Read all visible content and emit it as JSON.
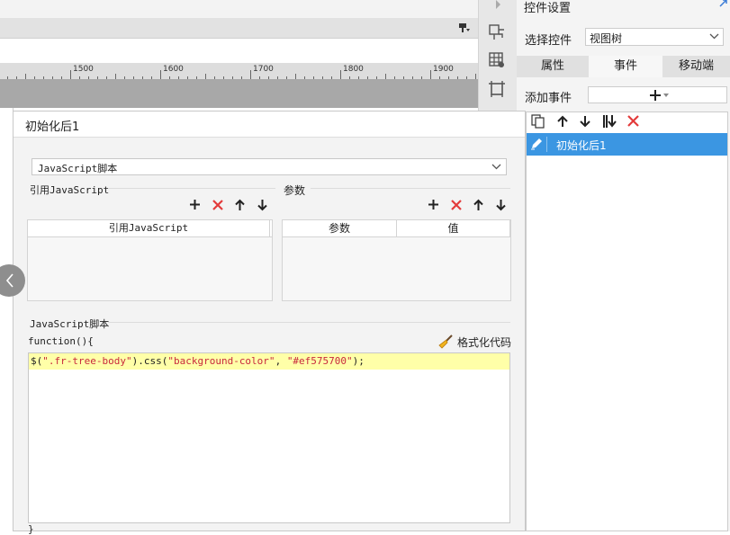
{
  "ruler": {
    "ticks": [
      "1500",
      "1600",
      "1700",
      "1800",
      "1900"
    ]
  },
  "right_panel": {
    "title": "控件设置",
    "select_label": "选择控件",
    "select_value": "视图树",
    "tabs": [
      "属性",
      "事件",
      "移动端"
    ],
    "active_tab": "事件",
    "add_event_label": "添加事件",
    "events": [
      {
        "label": "初始化后1",
        "selected": true
      }
    ]
  },
  "dialog": {
    "title": "初始化后1",
    "type_value": "JavaScript脚本",
    "ref_js_section": "引用JavaScript",
    "params_section": "参数",
    "ref_js_column": "引用JavaScript",
    "param_columns": [
      "参数",
      "值"
    ],
    "script_section": "JavaScript脚本",
    "function_header": "function(){",
    "format_label": "格式化代码",
    "code": {
      "dollar": "$(",
      "selector": "\".fr-tree-body\"",
      "method": ").css(",
      "arg1": "\"background-color\"",
      "comma": ", ",
      "arg2": "\"#ef575700\"",
      "end": ");"
    },
    "closing": "}"
  },
  "colors": {
    "accent": "#3b96e2",
    "delete_red": "#e33b3b",
    "code_highlight": "#ffffa8",
    "string_color": "#c8283c"
  }
}
